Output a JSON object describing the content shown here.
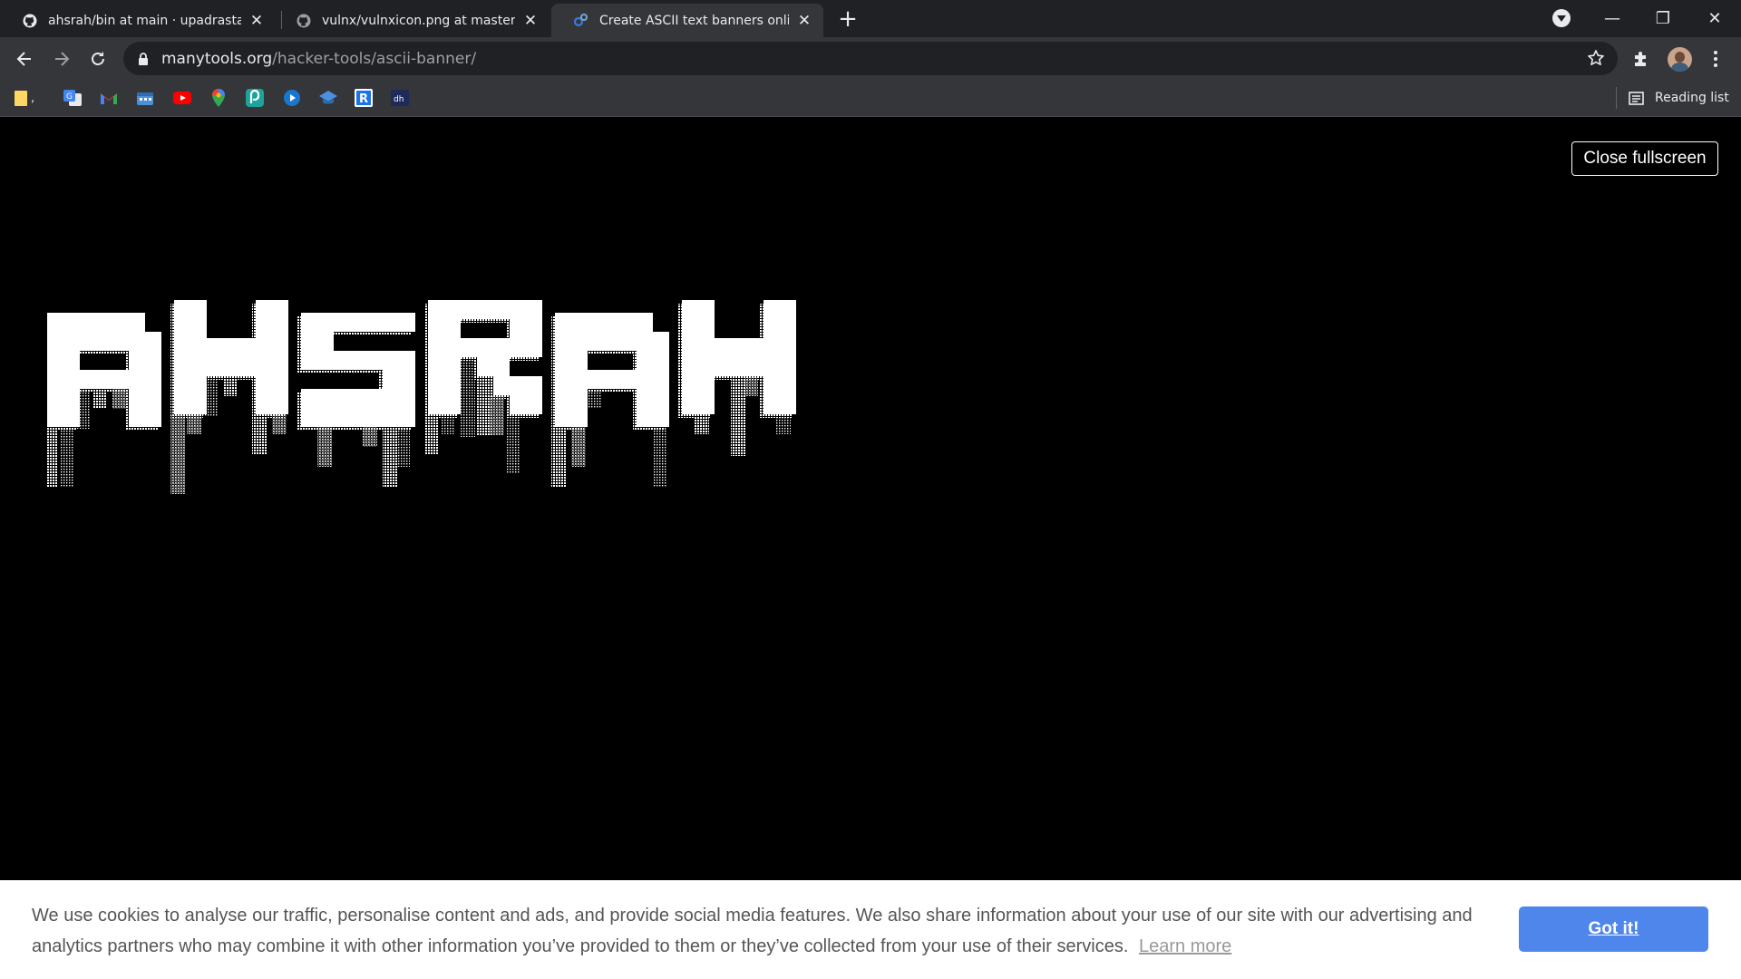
{
  "browser": {
    "tabs": [
      {
        "title": "ahsrah/bin at main · upadrastaha",
        "favicon": "github-icon",
        "active": false
      },
      {
        "title": "vulnx/vulnxicon.png at master · a",
        "favicon": "github-icon",
        "active": false
      },
      {
        "title": "Create ASCII text banners online",
        "favicon": "manytools-icon",
        "active": true
      }
    ],
    "tab_close_glyph": "✕",
    "new_tab_glyph": "+",
    "window_controls": {
      "minimize": "—",
      "restore": "❐",
      "close": "✕"
    },
    "address": {
      "host": "manytools.org",
      "path": "/hacker-tools/ascii-banner/"
    },
    "bookmarks": [
      {
        "icon": "folder-icon",
        "label": ","
      },
      {
        "icon": "google-translate-icon"
      },
      {
        "icon": "gmail-icon"
      },
      {
        "icon": "calendar-app-icon"
      },
      {
        "icon": "youtube-icon"
      },
      {
        "icon": "google-maps-icon"
      },
      {
        "icon": "teal-app-icon"
      },
      {
        "icon": "play-circle-icon"
      },
      {
        "icon": "graduation-cap-icon"
      },
      {
        "icon": "r-letter-icon"
      },
      {
        "icon": "dh-app-icon"
      }
    ],
    "reading_list_label": "Reading list"
  },
  "page": {
    "close_fullscreen_label": "Close fullscreen",
    "banner_text": "AHSRAH"
  },
  "cookie_banner": {
    "message": "We use cookies to analyse our traffic, personalise content and ads, and provide social media features. We also share information about your use of our site with our advertising and analytics partners who may combine it with other information you’ve provided to them or they’ve collected from your use of their services.",
    "learn_more": "Learn more",
    "accept": "Got it!"
  },
  "colors": {
    "tabstrip": "#202124",
    "toolbar": "#35363a",
    "accept_button": "#4f86ec",
    "page_background": "#000000",
    "banner_foreground": "#ffffff"
  }
}
